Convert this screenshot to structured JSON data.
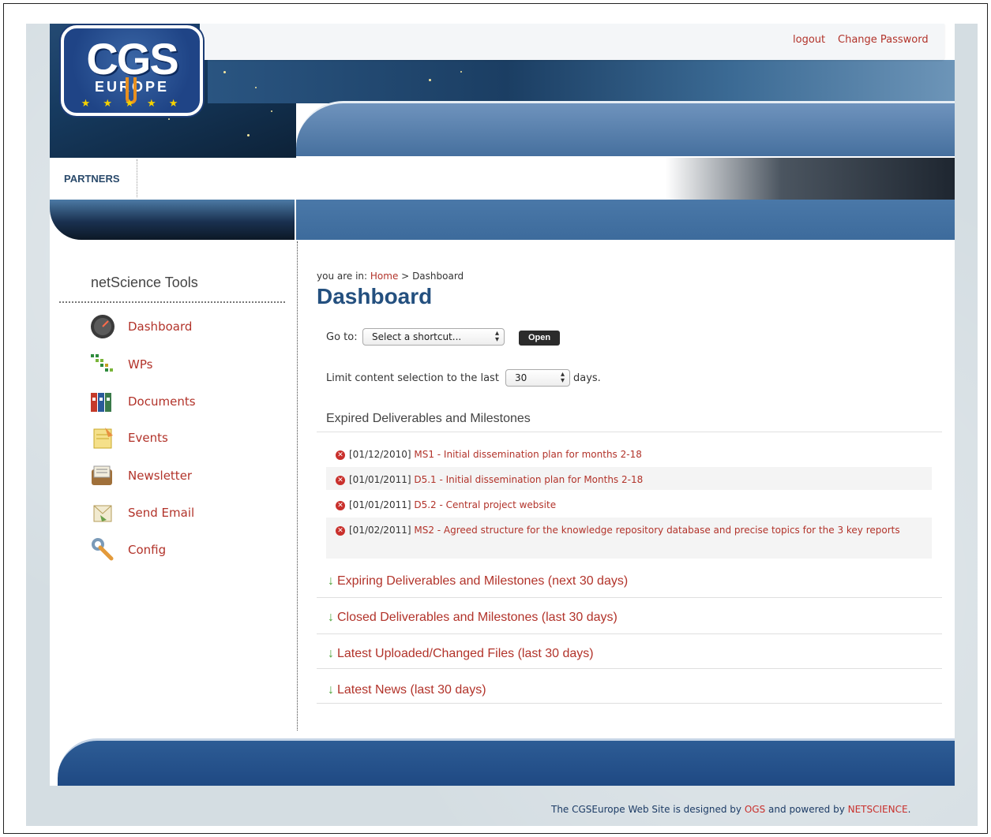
{
  "header": {
    "logo_text": "CGS",
    "logo_subtext": "EUROPE",
    "logo_stars": "★ ★ ★ ★ ★",
    "links": {
      "logout": "logout",
      "change_password": "Change Password"
    },
    "nav": {
      "partners": "PARTNERS"
    }
  },
  "sidebar": {
    "title": "netScience Tools",
    "items": [
      {
        "label": "Dashboard",
        "icon": "dashboard-icon"
      },
      {
        "label": "WPs",
        "icon": "wps-icon"
      },
      {
        "label": "Documents",
        "icon": "documents-icon"
      },
      {
        "label": "Events",
        "icon": "events-icon"
      },
      {
        "label": "Newsletter",
        "icon": "newsletter-icon"
      },
      {
        "label": "Send Email",
        "icon": "send-email-icon"
      },
      {
        "label": "Config",
        "icon": "config-icon"
      }
    ]
  },
  "main": {
    "breadcrumb": {
      "prefix": "you are in:",
      "home": "Home",
      "sep": ">",
      "current": "Dashboard"
    },
    "title": "Dashboard",
    "goto": {
      "label": "Go to:",
      "select_value": "Select a shortcut...",
      "button": "Open"
    },
    "limit": {
      "label": "Limit content selection to the last",
      "value": "30",
      "suffix": "days."
    },
    "expired": {
      "heading": "Expired Deliverables and Milestones",
      "rows": [
        {
          "date": "[01/12/2010]",
          "text": "MS1 - Initial dissemination plan for months 2-18"
        },
        {
          "date": "[01/01/2011]",
          "text": "D5.1 - Initial dissemination plan for Months 2-18"
        },
        {
          "date": "[01/01/2011]",
          "text": "D5.2 - Central project website"
        },
        {
          "date": "[01/02/2011]",
          "text": "MS2 - Agreed structure for the knowledge repository database and precise topics for the 3 key reports"
        }
      ]
    },
    "sections": [
      "Expiring Deliverables and Milestones (next 30 days)",
      "Closed Deliverables and Milestones (last 30 days)",
      "Latest Uploaded/Changed Files (last 30 days)",
      "Latest News (last 30 days)"
    ]
  },
  "footer": {
    "prefix": "The CGSEurope Web Site is designed by",
    "designer": "OGS",
    "middle": "and powered by",
    "powered_by": "NETSCIENCE",
    "suffix": "."
  },
  "colors": {
    "link": "#b2332a",
    "title": "#24507f",
    "header_blue": "#3d6b9c",
    "expired_icon": "#c9302c",
    "arrow_green": "#4ca23a"
  }
}
